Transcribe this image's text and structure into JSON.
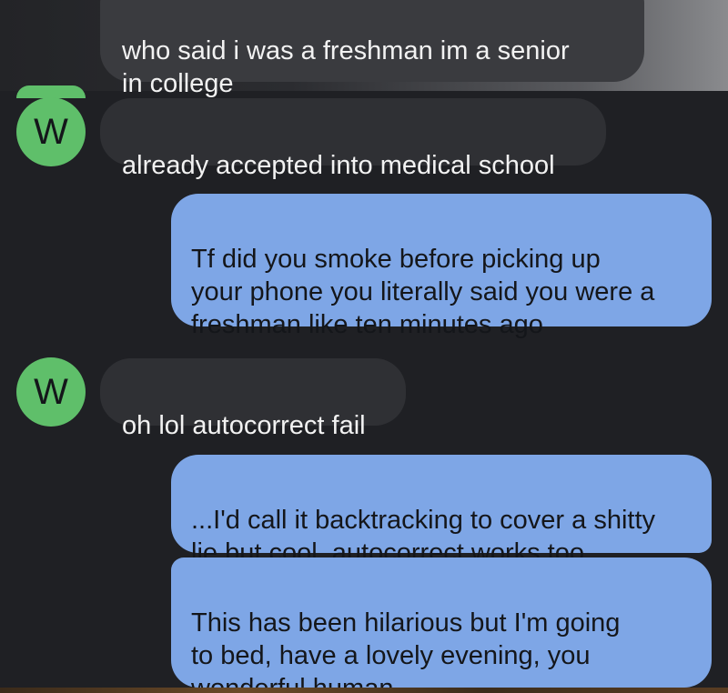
{
  "conversation": {
    "messages": [
      {
        "sender": "contact",
        "text": "who said i was a freshman im a senior\nin college"
      },
      {
        "sender": "contact",
        "avatar_letter": "W",
        "text": "already accepted into medical school"
      },
      {
        "sender": "me",
        "text": "Tf did you smoke before picking up\nyour phone you literally said you were a\nfreshman like ten minutes ago"
      },
      {
        "sender": "contact",
        "avatar_letter": "W",
        "text": "oh lol autocorrect fail"
      },
      {
        "sender": "me",
        "text": "...I'd call it backtracking to cover a shitty\nlie but cool, autocorrect works too"
      },
      {
        "sender": "me",
        "text": "This has been hilarious but I'm going\nto bed, have a lovely evening, you\nwonderful human"
      }
    ]
  },
  "colors": {
    "background": "#1f2024",
    "incoming_bubble": "#2f3034",
    "outgoing_bubble": "#7ea6e6",
    "avatar": "#5fbf6a"
  }
}
